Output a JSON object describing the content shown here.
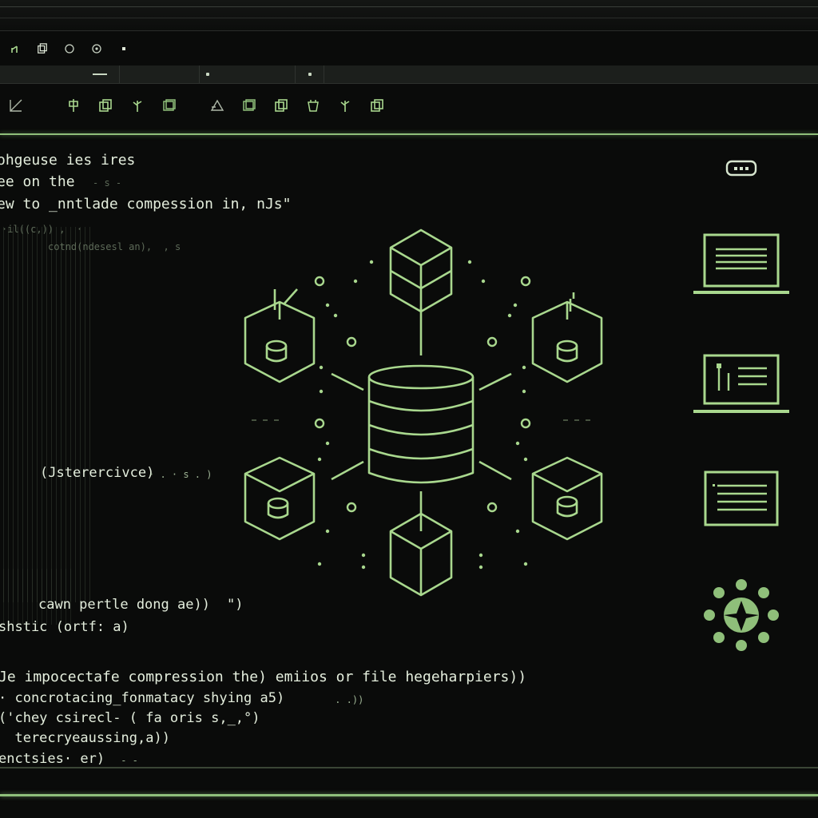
{
  "colors": {
    "accent": "#8fbf7a",
    "accent_bright": "#a9d88e",
    "background": "#0a0b0a",
    "text": "#e4eedd",
    "faint": "#5d6a58"
  },
  "window_controls": [
    "app-icon",
    "copy-icon",
    "circle-icon",
    "circle-dot-icon",
    "dot-icon"
  ],
  "tabs": [
    {
      "name": "tab-1"
    },
    {
      "name": "tab-2"
    },
    {
      "name": "tab-3"
    },
    {
      "name": "tab-4"
    }
  ],
  "toolbar_icons": [
    "slash-box-icon",
    "pin-icon",
    "copy-box-icon",
    "plant-icon",
    "layers-icon",
    "triangle-icon",
    "layers-icon",
    "copy-box-icon",
    "cup-icon",
    "plant-icon",
    "copy-box-icon"
  ],
  "editor": {
    "line1": "ohgeuse ies ires",
    "line2": "ee on the",
    "line2_faint": "- s -",
    "line3": "ew to _nntlade compession in, nJs\"",
    "line4_faint": "·il((c,)) ,  ·",
    "line5_faint": "cotnd(ndesesl an),  , s",
    "line6": "(Jsterercivce)",
    "line6_faint": "· . · s . )",
    "line7": "cawn pertle dong ae))",
    "line7_tail": "\")",
    "line8": "shstic (ortf: a)",
    "line9": "Je impocectafe compression the) emiios or file hegeharpiers))",
    "line10": "· concrotacing_fonmatacy shying a5)",
    "line10_faint": " . .))",
    "line11": "('chey csirecl- ( fa oris s,_,°)",
    "line12": "  terecryeaussing,a))",
    "line13": "enctsies· er)",
    "line13_faint": " - -"
  },
  "diagram": {
    "center": "database-icon",
    "nodes": [
      "cube-icon",
      "cube-icon",
      "cylinder-box-icon",
      "cylinder-box-icon",
      "cylinder-box-icon",
      "cylinder-box-icon"
    ]
  },
  "sidebar_icons": [
    "chat-bubble-icon",
    "laptop-icon",
    "laptop-chart-icon",
    "panel-list-icon",
    "flower-icon"
  ]
}
